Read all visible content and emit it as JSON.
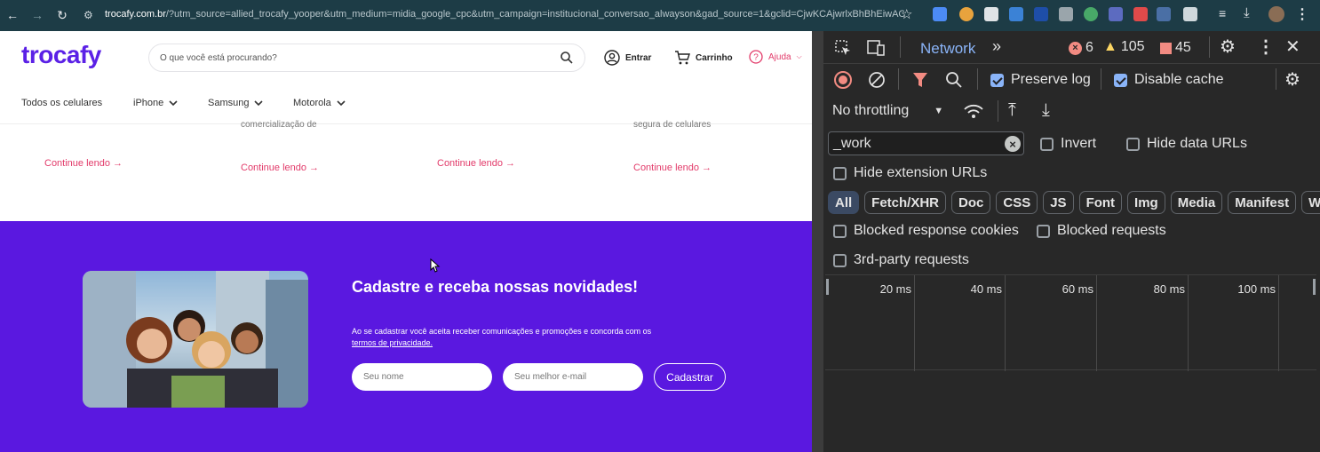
{
  "browser": {
    "url_domain": "trocafy.com.br",
    "url_rest": "/?utm_source=allied_trocafy_yooper&utm_medium=midia_google_cpc&utm_campaign=institucional_conversao_alwayson&gad_source=1&gclid=CjwKCAjwrlxBhBhEiwAC..."
  },
  "site": {
    "logo": "trocafy",
    "search_placeholder": "O que você está procurando?",
    "login": "Entrar",
    "cart": "Carrinho",
    "help": "Ajuda",
    "menu": [
      "Todos os celulares",
      "iPhone",
      "Samsung",
      "Motorola"
    ],
    "frag_1": "comercialização de",
    "frag_2": "segura de celulares",
    "continue": [
      "Continue lendo →",
      "Continue lendo →",
      "Continue lendo →",
      "Continue lendo →"
    ],
    "newsletter": {
      "title": "Cadastre e receba nossas novidades!",
      "text": "Ao se cadastrar você aceita receber comunicações e promoções e concorda com os",
      "link": "termos de privacidade.",
      "name_placeholder": "Seu nome",
      "email_placeholder": "Seu melhor e-mail",
      "button": "Cadastrar"
    }
  },
  "devtools": {
    "tab": "Network",
    "errors": "6",
    "warnings": "105",
    "issues": "45",
    "preserve_log": "Preserve log",
    "disable_cache": "Disable cache",
    "throttling": "No throttling",
    "filter_value": "_work",
    "invert": "Invert",
    "hide_data_urls": "Hide data URLs",
    "hide_ext_urls": "Hide extension URLs",
    "types": [
      "All",
      "Fetch/XHR",
      "Doc",
      "CSS",
      "JS",
      "Font",
      "Img",
      "Media",
      "Manifest",
      "WS"
    ],
    "blocked_cookies": "Blocked response cookies",
    "blocked_requests": "Blocked requests",
    "third_party": "3rd-party requests",
    "ticks": [
      "20 ms",
      "40 ms",
      "60 ms",
      "80 ms",
      "100 ms"
    ]
  },
  "colors": {
    "brand": "#5b21e6",
    "banner": "#5a18e0",
    "link": "#e23b6a"
  }
}
